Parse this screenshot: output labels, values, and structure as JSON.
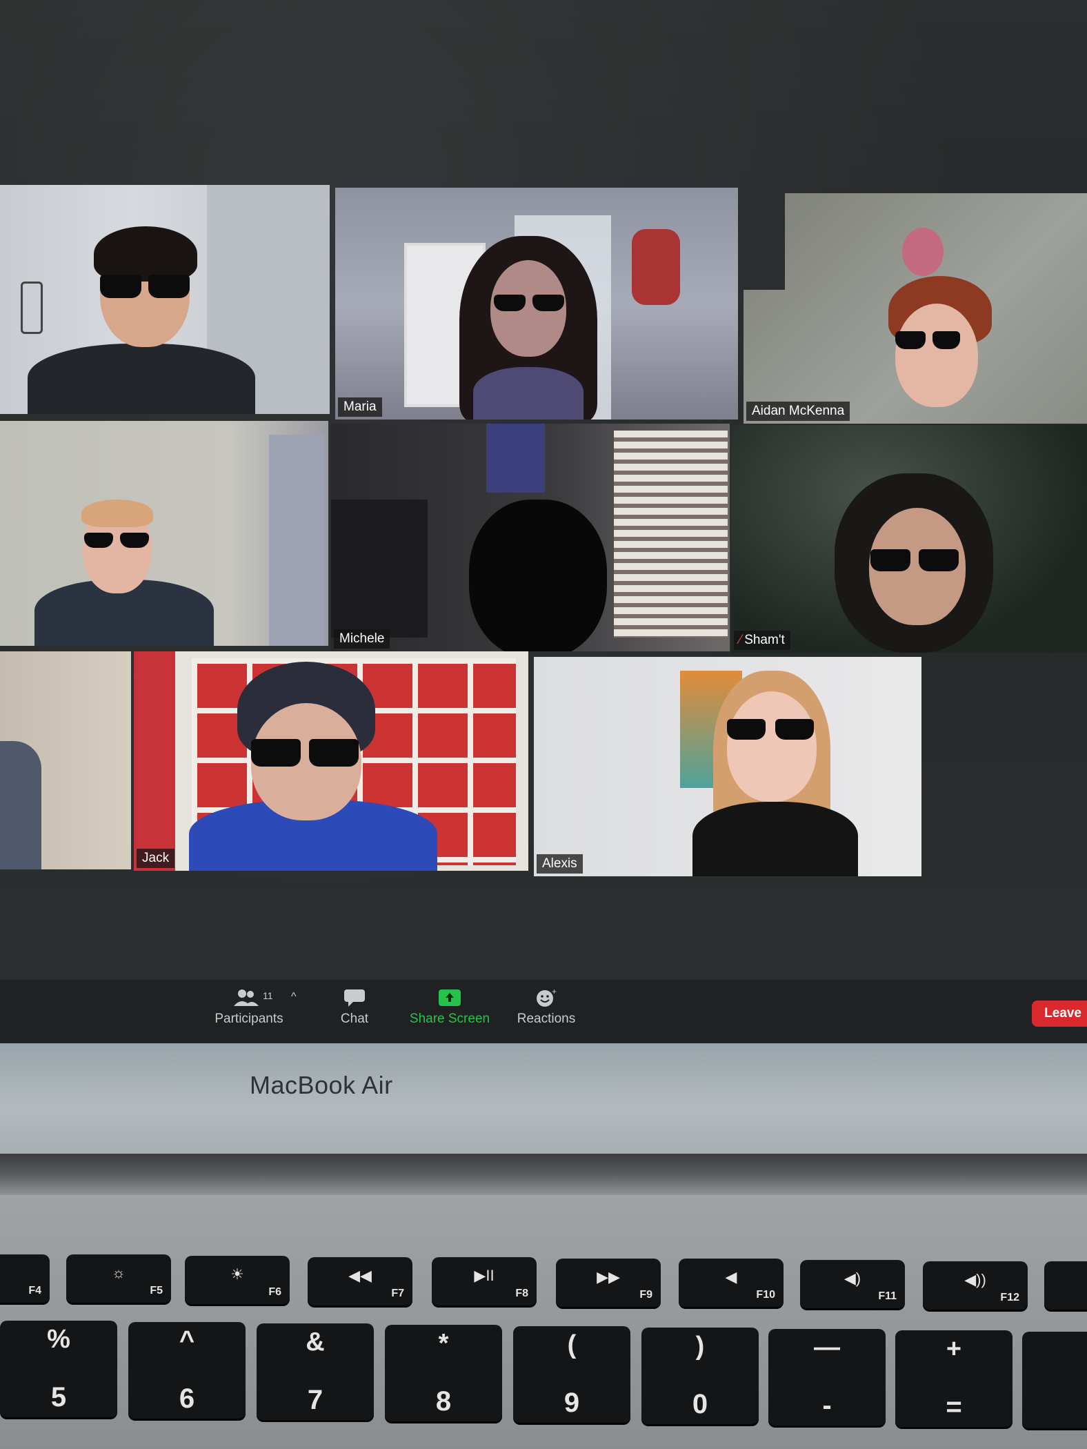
{
  "participants": [
    {
      "name": ""
    },
    {
      "name": "Maria"
    },
    {
      "name": "Aidan McKenna"
    },
    {
      "name": ""
    },
    {
      "name": "Michele"
    },
    {
      "name": "Sham't",
      "muted": true
    },
    {
      "name": ""
    },
    {
      "name": "Jack"
    },
    {
      "name": "Alexis"
    }
  ],
  "toolbar": {
    "participants_label": "Participants",
    "participants_count": "11",
    "chat_label": "Chat",
    "share_label": "Share Screen",
    "reactions_label": "Reactions",
    "leave_label": "Leave",
    "icons": [
      "participants-icon",
      "caret-up-icon",
      "chat-icon",
      "share-screen-icon",
      "reactions-icon"
    ]
  },
  "laptop": {
    "brand": "MacBook Air"
  },
  "keyboard": {
    "fn_row": [
      {
        "fn": "F4",
        "sym": ""
      },
      {
        "fn": "F5",
        "sym": "☼"
      },
      {
        "fn": "F6",
        "sym": "☀"
      },
      {
        "fn": "F7",
        "sym": "◀◀"
      },
      {
        "fn": "F8",
        "sym": "▶II"
      },
      {
        "fn": "F9",
        "sym": "▶▶"
      },
      {
        "fn": "F10",
        "sym": "◀"
      },
      {
        "fn": "F11",
        "sym": "◀)"
      },
      {
        "fn": "F12",
        "sym": "◀))"
      }
    ],
    "num_row": [
      {
        "top": "%",
        "bot": "5"
      },
      {
        "top": "^",
        "bot": "6"
      },
      {
        "top": "&",
        "bot": "7"
      },
      {
        "top": "*",
        "bot": "8"
      },
      {
        "top": "(",
        "bot": "9"
      },
      {
        "top": ")",
        "bot": "0"
      },
      {
        "top": "—",
        "bot": "-"
      },
      {
        "top": "+",
        "bot": "="
      }
    ]
  },
  "colors": {
    "share_green": "#27c24c",
    "leave_red": "#d9292c",
    "toolbar_bg": "#1f2122"
  }
}
